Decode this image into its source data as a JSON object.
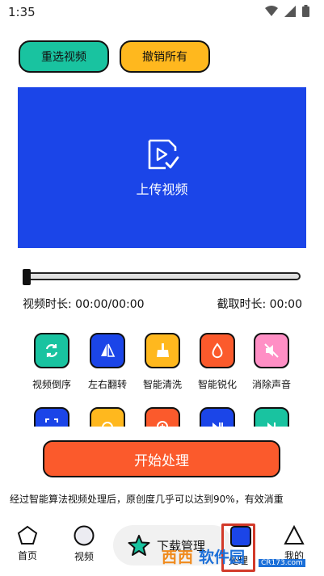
{
  "status_bar": {
    "time": "1:35",
    "icons": [
      "wifi-icon",
      "signal-icon",
      "battery-icon"
    ]
  },
  "top_buttons": {
    "reselect": "重选视频",
    "undo_all": "撤销所有"
  },
  "upload": {
    "label": "上传视频",
    "color": "#1b45e8"
  },
  "timeline": {
    "progress": 0
  },
  "times": {
    "duration": "视频时长: 00:00/00:00",
    "clip": "截取时长: 00:00"
  },
  "tools_row1": [
    {
      "label": "视频倒序",
      "color": "#19c3a0",
      "icon": "reverse-icon"
    },
    {
      "label": "左右翻转",
      "color": "#1b45e8",
      "icon": "flip-icon"
    },
    {
      "label": "智能清洗",
      "color": "#ffb81e",
      "icon": "brush-icon"
    },
    {
      "label": "智能锐化",
      "color": "#fb5a2c",
      "icon": "drop-icon"
    },
    {
      "label": "消除声音",
      "color": "#ff8fc5",
      "icon": "mute-icon"
    }
  ],
  "tools_row2_colors": [
    "#1b45e8",
    "#ffb81e",
    "#fb5a2c",
    "#1b45e8",
    "#19c3a0"
  ],
  "start_button": "开始处理",
  "description": "经过智能算法视频处理后，原创度几乎可以达到90%，有效消重",
  "nav": {
    "home": "首页",
    "video": "视频",
    "download": "下载管理",
    "process": "处理",
    "mine": "我的"
  },
  "watermark": {
    "text1": "西西",
    "text2": "软件园",
    "url": "CR173.com"
  }
}
